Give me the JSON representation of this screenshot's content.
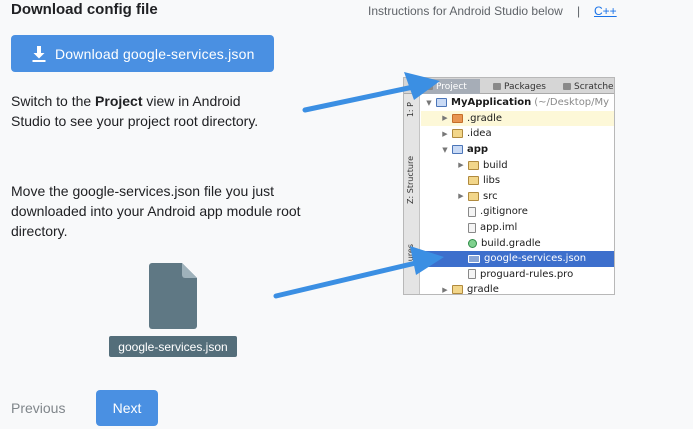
{
  "header": {
    "title": "Download config file",
    "instructions": "Instructions for Android Studio below",
    "separator": "|",
    "alt_link": "C++"
  },
  "download_button": {
    "label": "Download google-services.json",
    "icon": "download-icon"
  },
  "step1": {
    "prefix": "Switch to the ",
    "bold": "Project",
    "suffix": " view in Android Studio to see your project root directory."
  },
  "step2": {
    "text": "Move the google-services.json file you just downloaded into your Android app module root directory."
  },
  "file_preview": {
    "caption": "google-services.json",
    "icon": "file-icon"
  },
  "nav": {
    "previous": "Previous",
    "next": "Next"
  },
  "studio": {
    "tabs": [
      "Project",
      "Packages",
      "Scratches"
    ],
    "side_labels": [
      "1: P",
      "Z: Structure",
      "ures"
    ],
    "tree": [
      {
        "label": "MyApplication",
        "extra": "(~/Desktop/My",
        "icon": "module",
        "arrow": "▼",
        "indent": 0,
        "bold": true
      },
      {
        "label": ".gradle",
        "icon": "folder-red",
        "arrow": "▶",
        "indent": 1,
        "hl": true
      },
      {
        "label": ".idea",
        "icon": "folder",
        "arrow": "▶",
        "indent": 1
      },
      {
        "label": "app",
        "icon": "module",
        "arrow": "▼",
        "indent": 1,
        "bold": true
      },
      {
        "label": "build",
        "icon": "folder",
        "arrow": "▶",
        "indent": 2
      },
      {
        "label": "libs",
        "icon": "folder",
        "arrow": "",
        "indent": 2
      },
      {
        "label": "src",
        "icon": "folder",
        "arrow": "▶",
        "indent": 2
      },
      {
        "label": ".gitignore",
        "icon": "doc",
        "arrow": "",
        "indent": 2
      },
      {
        "label": "app.iml",
        "icon": "doc",
        "arrow": "",
        "indent": 2
      },
      {
        "label": "build.gradle",
        "icon": "gradle",
        "arrow": "",
        "indent": 2
      },
      {
        "label": "google-services.json",
        "icon": "json",
        "arrow": "",
        "indent": 2,
        "sel": true
      },
      {
        "label": "proguard-rules.pro",
        "icon": "doc",
        "arrow": "",
        "indent": 2
      },
      {
        "label": "gradle",
        "icon": "folder",
        "arrow": "▶",
        "indent": 1
      }
    ]
  },
  "colors": {
    "primary": "#4a90e2",
    "link": "#1a73e8",
    "caption_bg": "#546e7a",
    "arrow": "#3b8fe3"
  }
}
